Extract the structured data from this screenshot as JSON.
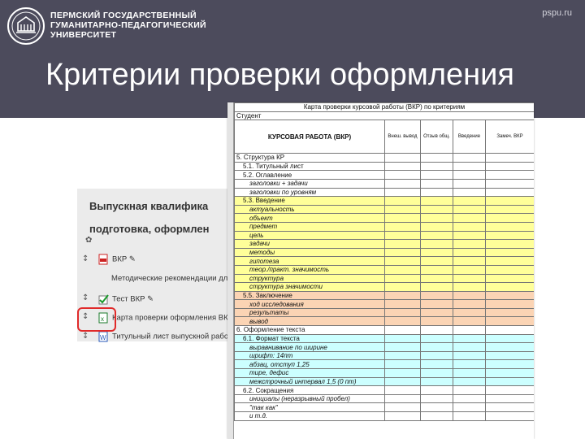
{
  "header": {
    "university": [
      "ПЕРМСКИЙ ГОСУДАРСТВЕННЫЙ",
      "ГУМАНИТАРНО-ПЕДАГОГИЧЕСКИЙ",
      "УНИВЕРСИТЕТ"
    ],
    "site": "pspu.ru",
    "title": "Критерии проверки оформления"
  },
  "course": {
    "title_line1": "Выпускная квалифика",
    "title_line2": "подготовка, оформлен",
    "activities": [
      {
        "label": "ВКР"
      },
      {
        "label": "Методические рекомендации дл"
      },
      {
        "label": "Тест ВКР"
      },
      {
        "label": "Карта проверки оформления ВКР"
      },
      {
        "label": "Титульный лист выпускной работ"
      }
    ]
  },
  "sheet": {
    "title": "Карта проверки курсовой работы (ВКР) по критериям",
    "student_label": "Студент",
    "work_label": "КУРСОВАЯ РАБОТА (ВКР)",
    "col_headers": [
      "Внеш. вывод",
      "Отзыв общ.",
      "Введение",
      "Замеч. ВКР"
    ],
    "row_numbers": [
      "1",
      "2",
      "",
      "",
      "",
      "",
      "5",
      "6",
      "7",
      "8",
      "9",
      "0",
      "1",
      "2",
      "3",
      "4",
      "5",
      "6",
      "7",
      "8",
      "9",
      "0",
      "1",
      "2",
      "3",
      "4",
      "5",
      "6",
      "7",
      "8",
      "9",
      "0",
      "1",
      "2",
      "3",
      "4",
      "5"
    ],
    "rows": [
      {
        "text": "5. Структура КР",
        "style": "plain",
        "indent": 0
      },
      {
        "text": "5.1. Титульный лист",
        "style": "plain",
        "indent": 1
      },
      {
        "text": "5.2. Оглавление",
        "style": "plain",
        "indent": 1
      },
      {
        "text": "заголовки + задачи",
        "style": "plain",
        "indent": 2
      },
      {
        "text": "заголовки по уровням",
        "style": "plain",
        "indent": 2
      },
      {
        "text": "5.3. Введение",
        "style": "yellow",
        "indent": 1
      },
      {
        "text": "актуальность",
        "style": "yellow",
        "indent": 2
      },
      {
        "text": "объект",
        "style": "yellow",
        "indent": 2
      },
      {
        "text": "предмет",
        "style": "yellow",
        "indent": 2
      },
      {
        "text": "цель",
        "style": "yellow",
        "indent": 2
      },
      {
        "text": "задачи",
        "style": "yellow",
        "indent": 2
      },
      {
        "text": "методы",
        "style": "yellow",
        "indent": 2
      },
      {
        "text": "гипотеза",
        "style": "yellow",
        "indent": 2
      },
      {
        "text": "теор./практ. значимость",
        "style": "yellow",
        "indent": 2
      },
      {
        "text": "структура",
        "style": "yellow",
        "indent": 2
      },
      {
        "text": "структура значимости",
        "style": "yellow",
        "indent": 2
      },
      {
        "text": "5.5. Заключение",
        "style": "orange",
        "indent": 1
      },
      {
        "text": "ход исследования",
        "style": "orange",
        "indent": 2
      },
      {
        "text": "результаты",
        "style": "orange",
        "indent": 2
      },
      {
        "text": "вывод",
        "style": "orange",
        "indent": 2
      },
      {
        "text": "6. Оформление текста",
        "style": "plain",
        "indent": 0
      },
      {
        "text": "6.1. Формат текста",
        "style": "cyan",
        "indent": 1
      },
      {
        "text": "выравнивание по ширине",
        "style": "cyan",
        "indent": 2
      },
      {
        "text": "шрифт: 14пт",
        "style": "cyan",
        "indent": 2
      },
      {
        "text": "абзац, отступ 1,25",
        "style": "cyan",
        "indent": 2
      },
      {
        "text": "тире, дефис",
        "style": "cyan",
        "indent": 2
      },
      {
        "text": "межстрочный интервал 1,5 (0 пт)",
        "style": "cyan",
        "indent": 2
      },
      {
        "text": "6.2. Сокращения",
        "style": "plain",
        "indent": 1
      },
      {
        "text": "инициалы (неразрывный пробел)",
        "style": "plain",
        "indent": 2
      },
      {
        "text": "\"так как\"",
        "style": "plain",
        "indent": 2
      },
      {
        "text": "и т.д.",
        "style": "plain",
        "indent": 2
      }
    ]
  },
  "colors": {
    "header_bg": "#4c4b5c",
    "yellow": "#ffff99",
    "orange": "#fbd4b4",
    "cyan": "#ccffff",
    "highlight": "#e02a2a"
  }
}
